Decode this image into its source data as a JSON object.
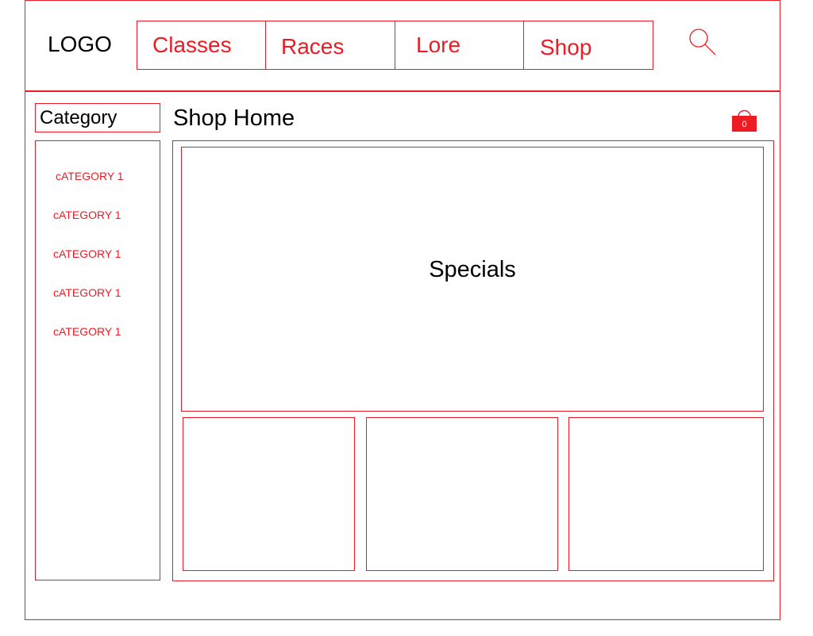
{
  "header": {
    "logo": "LOGO",
    "nav": [
      {
        "label": "Classes"
      },
      {
        "label": "Races"
      },
      {
        "label": "Lore"
      },
      {
        "label": "Shop"
      }
    ],
    "search_icon": "search-icon"
  },
  "sidebar": {
    "title": "Category",
    "items": [
      {
        "label": "cATEGORY 1"
      },
      {
        "label": "cATEGORY 1"
      },
      {
        "label": "cATEGORY 1"
      },
      {
        "label": "cATEGORY 1"
      },
      {
        "label": "cATEGORY 1"
      }
    ]
  },
  "main": {
    "title": "Shop Home",
    "cart": {
      "icon": "shopping-bag-icon",
      "count": "0"
    },
    "specials_label": "Specials"
  },
  "colors": {
    "accent": "#ed1c24",
    "text": "#000000",
    "background": "#ffffff"
  }
}
